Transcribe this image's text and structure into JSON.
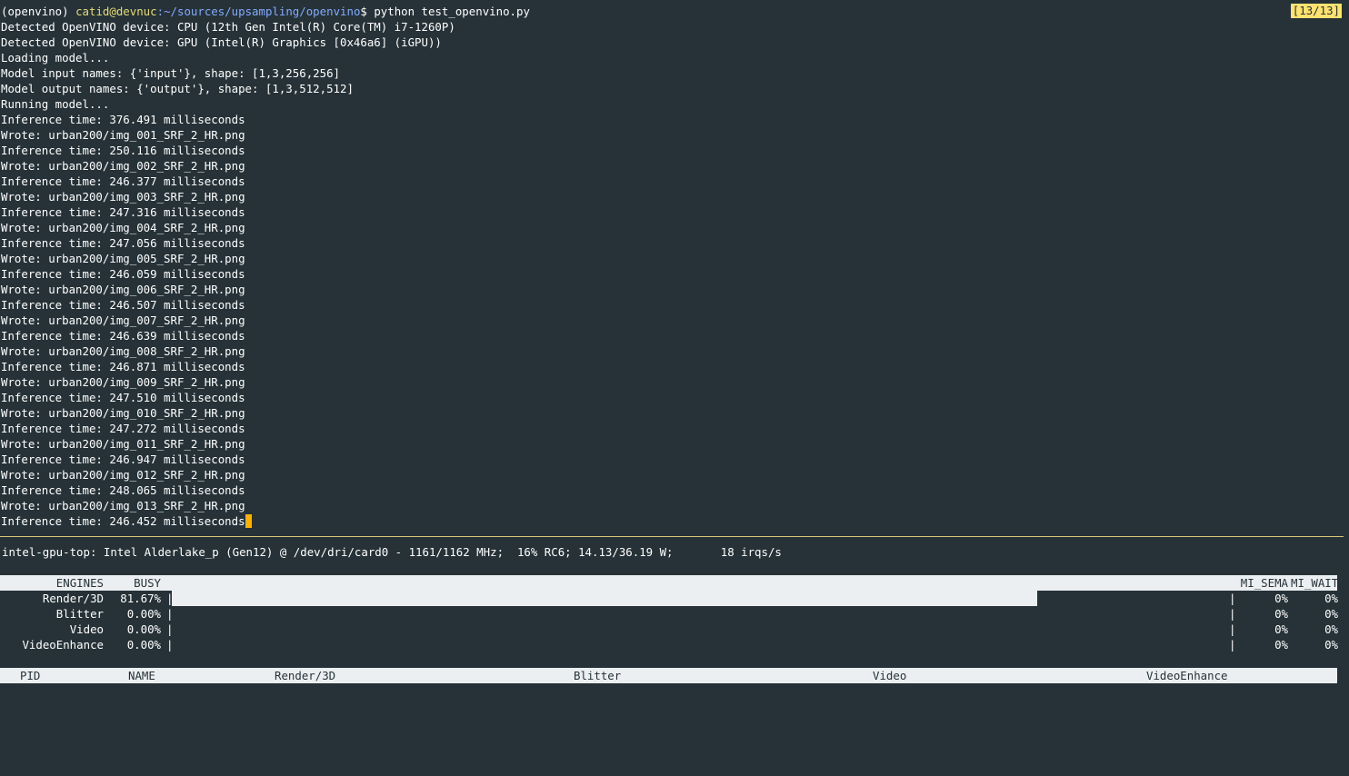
{
  "prompt": {
    "env": "(openvino)",
    "user_host": "catid@devnuc",
    "path": ":~/sources/upsampling/openvino",
    "symbol": "$",
    "command": " python test_openvino.py"
  },
  "pane_index": "[13/13]",
  "output_lines": [
    "Detected OpenVINO device: CPU (12th Gen Intel(R) Core(TM) i7-1260P)",
    "Detected OpenVINO device: GPU (Intel(R) Graphics [0x46a6] (iGPU))",
    "Loading model...",
    "Model input names: {'input'}, shape: [1,3,256,256]",
    "Model output names: {'output'}, shape: [1,3,512,512]",
    "Running model...",
    "Inference time: 376.491 milliseconds",
    "Wrote: urban200/img_001_SRF_2_HR.png",
    "Inference time: 250.116 milliseconds",
    "Wrote: urban200/img_002_SRF_2_HR.png",
    "Inference time: 246.377 milliseconds",
    "Wrote: urban200/img_003_SRF_2_HR.png",
    "Inference time: 247.316 milliseconds",
    "Wrote: urban200/img_004_SRF_2_HR.png",
    "Inference time: 247.056 milliseconds",
    "Wrote: urban200/img_005_SRF_2_HR.png",
    "Inference time: 246.059 milliseconds",
    "Wrote: urban200/img_006_SRF_2_HR.png",
    "Inference time: 246.507 milliseconds",
    "Wrote: urban200/img_007_SRF_2_HR.png",
    "Inference time: 246.639 milliseconds",
    "Wrote: urban200/img_008_SRF_2_HR.png",
    "Inference time: 246.871 milliseconds",
    "Wrote: urban200/img_009_SRF_2_HR.png",
    "Inference time: 247.510 milliseconds",
    "Wrote: urban200/img_010_SRF_2_HR.png",
    "Inference time: 247.272 milliseconds",
    "Wrote: urban200/img_011_SRF_2_HR.png",
    "Inference time: 246.947 milliseconds",
    "Wrote: urban200/img_012_SRF_2_HR.png",
    "Inference time: 248.065 milliseconds",
    "Wrote: urban200/img_013_SRF_2_HR.png"
  ],
  "last_line": "Inference time: 246.452 milliseconds",
  "gputop": {
    "header": "intel-gpu-top: Intel Alderlake_p (Gen12) @ /dev/dri/card0 - 1161/1162 MHz;  16% RC6; 14.13/36.19 W;       18 irqs/s",
    "engine_cols": {
      "engines": "ENGINES",
      "busy": "BUSY",
      "mi_sema": "MI_SEMA",
      "mi_wait": "MI_WAIT"
    },
    "engines": [
      {
        "name": "Render/3D",
        "busy": "81.67%",
        "busy_fraction": 0.8167,
        "sep": "|",
        "end_sep": "|",
        "mi_sema": "0%",
        "mi_wait": "0%"
      },
      {
        "name": "Blitter",
        "busy": "0.00%",
        "busy_fraction": 0,
        "sep": "|",
        "end_sep": "|",
        "mi_sema": "0%",
        "mi_wait": "0%"
      },
      {
        "name": "Video",
        "busy": "0.00%",
        "busy_fraction": 0,
        "sep": "|",
        "end_sep": "|",
        "mi_sema": "0%",
        "mi_wait": "0%"
      },
      {
        "name": "VideoEnhance",
        "busy": "0.00%",
        "busy_fraction": 0,
        "sep": "|",
        "end_sep": "|",
        "mi_sema": "0%",
        "mi_wait": "0%"
      }
    ],
    "client_cols": {
      "pid": "PID",
      "name": "NAME",
      "render": "Render/3D",
      "blitter": "Blitter",
      "video": "Video",
      "videoenhance": "VideoEnhance"
    }
  },
  "colors": {
    "background": "#263238",
    "prompt_user": "#e6db74",
    "prompt_path": "#82aaff",
    "cursor": "#ffb000",
    "pane_badge": "#ffe36e",
    "bar": "#eceff1"
  }
}
